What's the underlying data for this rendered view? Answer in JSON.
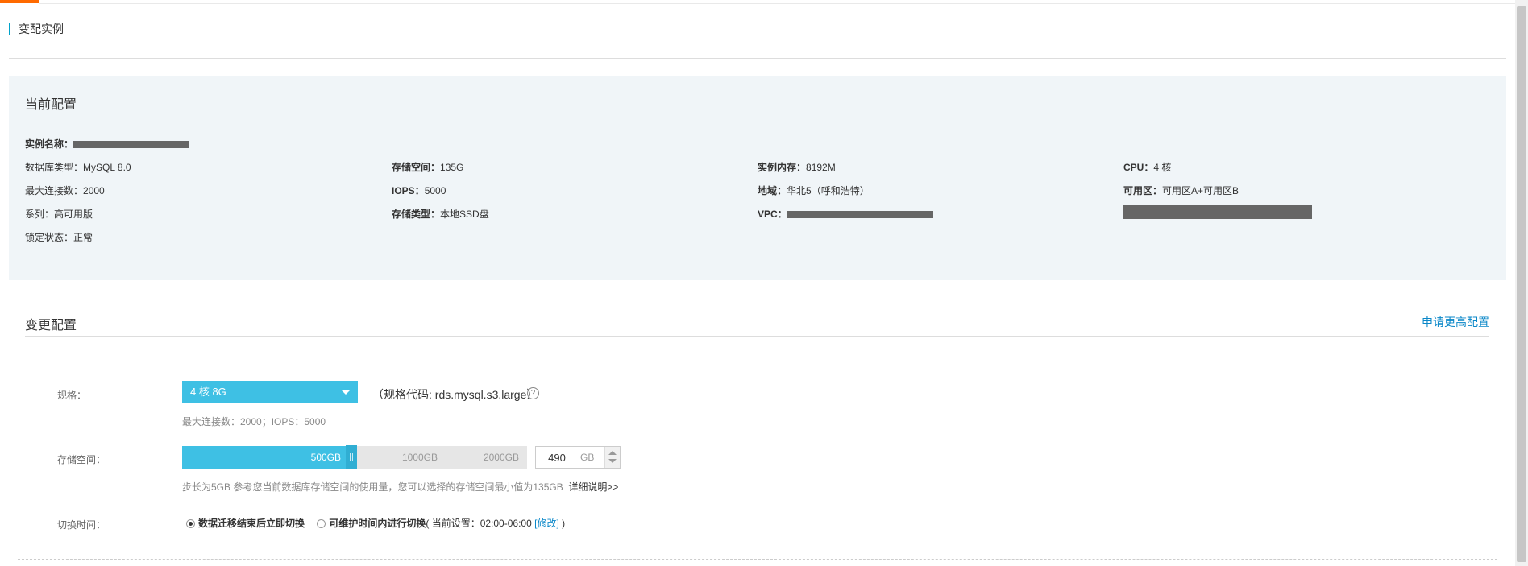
{
  "page": {
    "title": "变配实例"
  },
  "current_config": {
    "title": "当前配置",
    "instance_name_label": "实例名称：",
    "db_type_label": "数据库类型：",
    "db_type_value": "MySQL 8.0",
    "storage_label": "存储空间：",
    "storage_value": "135G",
    "memory_label": "实例内存：",
    "memory_value": "8192M",
    "cpu_label": "CPU：",
    "cpu_value": "4 核",
    "max_conn_label": "最大连接数：",
    "max_conn_value": "2000",
    "iops_label": "IOPS：",
    "iops_value": "5000",
    "region_label": "地域：",
    "region_value": "华北5（呼和浩特）",
    "zone_label": "可用区：",
    "zone_value": "可用区A+可用区B",
    "series_label": "系列：",
    "series_value": "高可用版",
    "storage_type_label": "存储类型：",
    "storage_type_value": "本地SSD盘",
    "vpc_label": "VPC：",
    "lock_label": "锁定状态：",
    "lock_value": "正常"
  },
  "change_config": {
    "title": "变更配置",
    "request_link": "申请更高配置",
    "spec": {
      "label": "规格：",
      "selected": "4 核 8G",
      "code_text": "（规格代码: rds.mysql.s3.large）",
      "help_icon": "question-circle-icon",
      "hint": "最大连接数：2000；IOPS：5000"
    },
    "storage": {
      "label": "存储空间：",
      "ticks": [
        "500GB",
        "1000GB",
        "2000GB"
      ],
      "fill_fraction": 0.25,
      "value": "490",
      "unit": "GB",
      "hint": "步长为5GB 参考您当前数据库存储空间的使用量，您可以选择的存储空间最小值为135GB",
      "detail_link": "详细说明>>"
    },
    "switch_time": {
      "label": "切换时间：",
      "option_immediate": "数据迁移结束后立即切换",
      "option_maintenance": "可维护时间内进行切换",
      "current_prefix": "( 当前设置：02:00-06:00 ",
      "modify_link": "[修改]",
      "current_suffix": " )",
      "selected": "immediate"
    }
  },
  "colors": {
    "accent": "#3ec0e4",
    "link": "#0a87c8",
    "top_accent": "#ff6a00",
    "panel_bg": "#f0f5f8"
  }
}
